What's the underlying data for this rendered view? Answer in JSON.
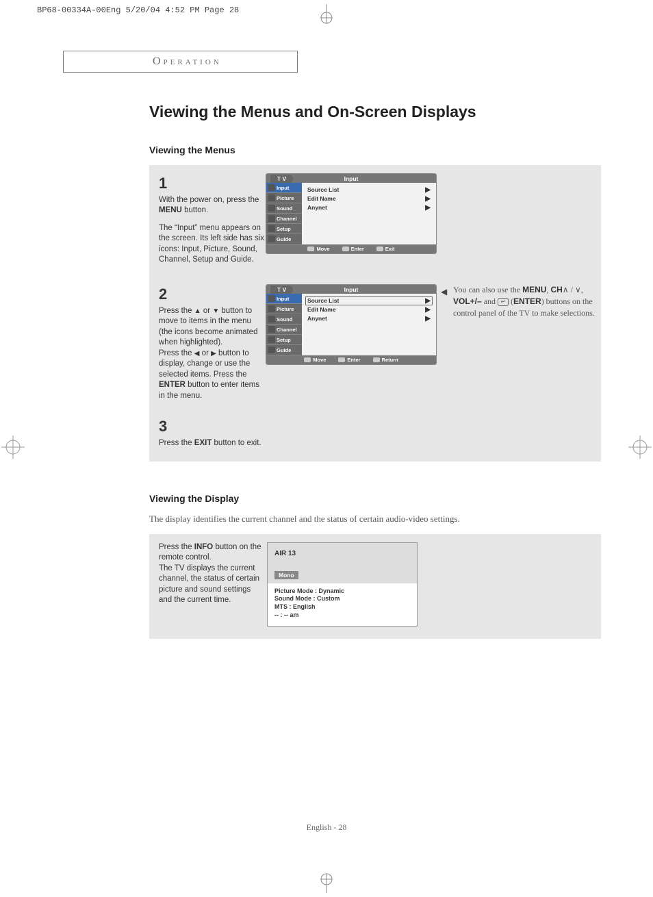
{
  "meta_header": "BP68-00334A-00Eng  5/20/04  4:52 PM  Page 28",
  "chapter": "Operation",
  "title": "Viewing the Menus and On-Screen Displays",
  "section1": "Viewing the Menus",
  "step1": {
    "num": "1",
    "text_pre": "With the power on, press the ",
    "btn": "MENU",
    "text_post": " button.",
    "para2": "The “Input” menu appears on the screen. Its left side has six icons: Input, Picture, Sound, Channel, Setup and Guide."
  },
  "step2": {
    "num": "2",
    "l1a": "Press the ",
    "l1b": " or ",
    "l1c": " button to move to items in the menu (the icons become animated when highlighted).",
    "l2a": "Press the ",
    "l2b": " or ",
    "l2c": " button to display, change or use the selected items. Press the ",
    "l2btn": "ENTER",
    "l2d": " button to enter items in the menu."
  },
  "step3": {
    "num": "3",
    "text_pre": "Press the ",
    "btn": "EXIT",
    "text_post": " button to exit."
  },
  "osd": {
    "tv": "T V",
    "title": "Input",
    "side": [
      "Input",
      "Picture",
      "Sound",
      "Channel",
      "Setup",
      "Guide"
    ],
    "rows": [
      "Source List",
      "Edit Name",
      "Anynet"
    ],
    "foot_move": "Move",
    "foot_enter": "Enter",
    "foot_exit": "Exit",
    "foot_return": "Return"
  },
  "sidenote": {
    "l1a": "You can also use the ",
    "menu": "MENU",
    "l1b": ", ",
    "ch": "CH",
    "slash": " / ",
    "l1c": ", ",
    "vol": "VOL+/–",
    "l1d": " and ",
    "enter": "ENTER",
    "l1e": ") buttons on the control panel of the TV to make selections."
  },
  "section2": "Viewing the Display",
  "section2_intro": "The display identifies the current channel and the status of certain audio-video settings.",
  "display_step": {
    "pre": "Press the ",
    "btn": "INFO",
    "post": " button on the remote control.",
    "para2": "The TV displays the current channel, the status of certain picture and sound settings and the current time."
  },
  "info": {
    "ch": "AIR  13",
    "mono": "Mono",
    "l1": "Picture Mode : Dynamic",
    "l2": "Sound Mode : Custom",
    "l3": "MTS : English",
    "l4": "-- : -- am"
  },
  "footer": "English - 28"
}
